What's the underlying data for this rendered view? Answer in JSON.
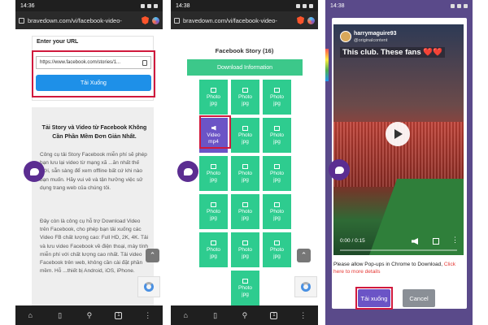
{
  "screen1": {
    "status_time": "14:36",
    "url": "bravedown.com/vi/facebook-video-",
    "url_label": "Enter your URL",
    "url_value": "https://www.facebook.com/stories/1...",
    "download_button": "Tải Xuống",
    "heading": "Tải Story và Video từ Facebook Không Cần Phần Mềm Đơn Giản Nhất.",
    "paragraph1": "Công cụ tải Story Facebook miễn phí sẽ phép bạn lưu lại video từ mạng xã ...ăn nhất thế giới, sẵn sàng để xem offline bất cứ khi nào bạn muốn. Hãy vui vẻ và tận hưởng việc sử dụng trang web của chúng tôi.",
    "paragraph2": "Đây còn là công cụ hỗ trợ Download Video trên Facebook, cho phép bạn tải xuống các Video FB chất lượng cao: Full HD, 2K, 4K. Tải và lưu video Facebook về điện thoại, máy tính miễn phí với chất lượng cao nhất. Tải video Facebook trên web, không cần cài đặt phần mềm. Hỗ ...thiết bị Android, iOS, iPhone.",
    "tab_count": "1"
  },
  "screen2": {
    "status_time": "14:38",
    "url": "bravedown.com/vi/facebook-video-",
    "title": "Facebook Story (16)",
    "download_info": "Download Information",
    "tiles": [
      {
        "line1": "Photo",
        "line2": "jpg",
        "type": "photo"
      },
      {
        "line1": "Photo",
        "line2": "jpg",
        "type": "photo"
      },
      {
        "line1": "Photo",
        "line2": "jpg",
        "type": "photo"
      },
      {
        "line1": "Video",
        "line2": "mp4",
        "type": "video"
      },
      {
        "line1": "Photo",
        "line2": "jpg",
        "type": "photo"
      },
      {
        "line1": "Photo",
        "line2": "jpg",
        "type": "photo"
      },
      {
        "line1": "Photo",
        "line2": "jpg",
        "type": "photo"
      },
      {
        "line1": "Photo",
        "line2": "jpg",
        "type": "photo"
      },
      {
        "line1": "Photo",
        "line2": "jpg",
        "type": "photo"
      },
      {
        "line1": "Photo",
        "line2": "jpg",
        "type": "photo"
      },
      {
        "line1": "Photo",
        "line2": "jpg",
        "type": "photo"
      },
      {
        "line1": "Photo",
        "line2": "jpg",
        "type": "photo"
      },
      {
        "line1": "Photo",
        "line2": "jpg",
        "type": "photo"
      },
      {
        "line1": "Photo",
        "line2": "jpg",
        "type": "photo"
      },
      {
        "line1": "Photo",
        "line2": "jpg",
        "type": "photo"
      },
      {
        "line1": "Photo",
        "line2": "jpg",
        "type": "photo"
      }
    ],
    "tab_count": "1"
  },
  "screen3": {
    "status_time": "14:38",
    "username": "harrymaguire93",
    "subline": "@originalcontent",
    "caption": "This club. These fans ❤️❤️",
    "time": "0:00 / 0:15",
    "note_text": "Please allow Pop-ups in Chrome to Download, ",
    "note_link": "Click here to more details",
    "download_button": "Tải xuống",
    "cancel_button": "Cancel"
  },
  "colors": {
    "highlight": "#d0193d",
    "primary_blue": "#1e90e8",
    "green": "#2ecc8f",
    "purple": "#6b54c6"
  }
}
